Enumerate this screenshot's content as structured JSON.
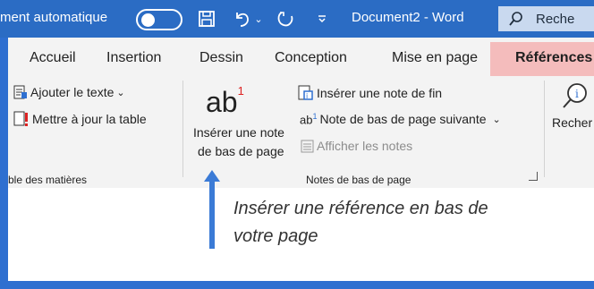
{
  "titlebar": {
    "autosave_label": "ment automatique",
    "document_title": "Document2  -  Word",
    "search_text": "Reche"
  },
  "tabs": [
    "Accueil",
    "Insertion",
    "Dessin",
    "Conception",
    "Mise en page"
  ],
  "active_tab": "Références",
  "toc_group": {
    "add_text": "Ajouter le texte",
    "update_table": "Mettre à jour la table",
    "label": "ble des matières"
  },
  "footnotes_group": {
    "insert_footnote_line1": "Insérer une note",
    "insert_footnote_line2": "de bas de page",
    "insert_endnote": "Insérer une note de fin",
    "next_footnote": "Note de bas de page suivante",
    "show_notes": "Afficher les notes",
    "label": "Notes de bas de page"
  },
  "research_group": {
    "label": "Recher"
  },
  "annotation": {
    "line1": "Insérer une référence en bas de",
    "line2": "votre page"
  },
  "colors": {
    "titlebar": "#2b6cc4",
    "active_tab": "#f4bcbc",
    "arrow": "#3b7bd6"
  }
}
